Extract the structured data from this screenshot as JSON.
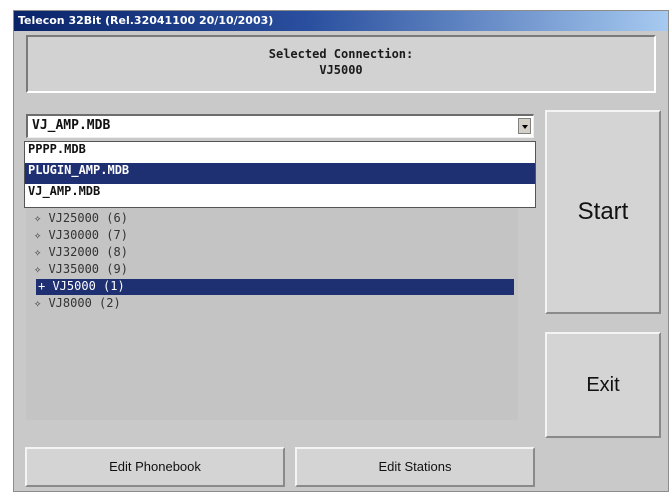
{
  "window": {
    "title": "Telecon 32Bit (Rel.32041100 20/10/2003)"
  },
  "connection": {
    "heading": "Selected Connection:",
    "name": "VJ5000"
  },
  "database_select": {
    "value": "VJ_AMP.MDB",
    "options": [
      {
        "label": "PPPP.MDB",
        "selected": false
      },
      {
        "label": "PLUGIN_AMP.MDB",
        "selected": true
      },
      {
        "label": "VJ_AMP.MDB",
        "selected": false
      }
    ]
  },
  "stations": [
    {
      "label": "✧ VJ25000 (6)",
      "selected": false
    },
    {
      "label": "✧ VJ30000 (7)",
      "selected": false
    },
    {
      "label": "✧ VJ32000 (8)",
      "selected": false
    },
    {
      "label": "✧ VJ35000 (9)",
      "selected": false
    },
    {
      "label": "+ VJ5000 (1)",
      "selected": true
    },
    {
      "label": "✧ VJ8000 (2)",
      "selected": false
    }
  ],
  "buttons": {
    "start": "Start",
    "exit": "Exit",
    "edit_phonebook": "Edit Phonebook",
    "edit_stations": "Edit Stations"
  },
  "colors": {
    "selection": "#1e2f72",
    "title_start": "#0a246a",
    "title_end": "#a6caf0",
    "window_bg": "#c9c9c9"
  }
}
